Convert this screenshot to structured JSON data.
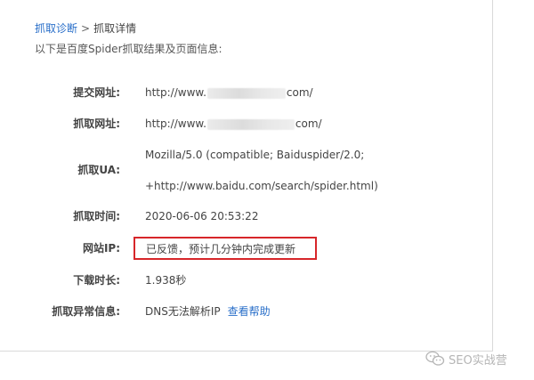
{
  "breadcrumb": {
    "root": "抓取诊断",
    "separator": ">",
    "current": "抓取详情"
  },
  "intro": "以下是百度Spider抓取结果及页面信息:",
  "fields": {
    "submitted_url": {
      "label": "提交网址:",
      "prefix": "http://www.",
      "suffix": "com/"
    },
    "crawled_url": {
      "label": "抓取网址:",
      "prefix": "http://www.",
      "suffix": "com/"
    },
    "ua": {
      "label": "抓取UA:",
      "line1": "Mozilla/5.0 (compatible; Baiduspider/2.0;",
      "line2": "+http://www.baidu.com/search/spider.html)"
    },
    "crawl_time": {
      "label": "抓取时间:",
      "value": "2020-06-06 20:53:22"
    },
    "site_ip": {
      "label": "网站IP:",
      "value": "已反馈，预计几分钟内完成更新"
    },
    "download_time": {
      "label": "下载时长:",
      "value": "1.938秒"
    },
    "crawl_error": {
      "label": "抓取异常信息:",
      "value": "DNS无法解析IP",
      "help_link": "查看帮助"
    }
  },
  "watermark": {
    "text": "SEO实战营",
    "icon": "wechat-icon"
  },
  "colors": {
    "link": "#2a6fc9",
    "highlight_border": "#d7262a",
    "text": "#444444"
  }
}
